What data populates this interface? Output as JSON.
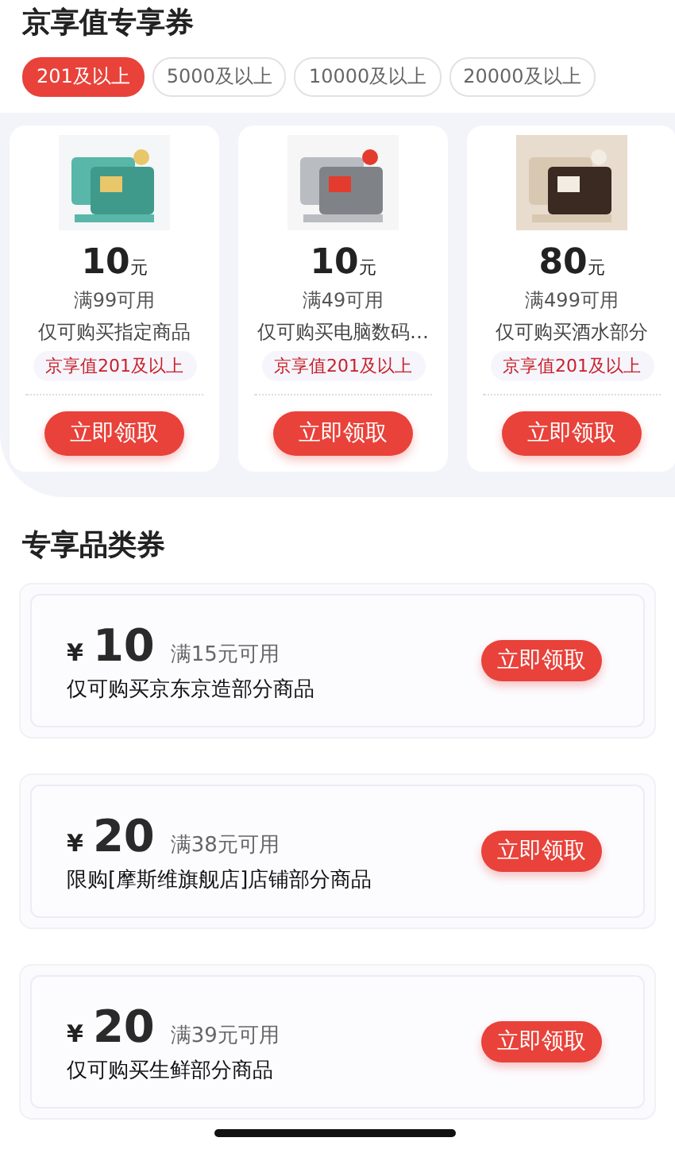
{
  "section_title": "京享值专享券",
  "tabs": [
    {
      "label": "201及以上",
      "selected": true
    },
    {
      "label": "5000及以上",
      "selected": false
    },
    {
      "label": "10000及以上",
      "selected": false
    },
    {
      "label": "20000及以上",
      "selected": false
    }
  ],
  "product_coupons": [
    {
      "amount": "10",
      "unit": "元",
      "condition": "满99可用",
      "scope": "仅可购买指定商品",
      "tag": "京享值201及以上",
      "button": "立即领取"
    },
    {
      "amount": "10",
      "unit": "元",
      "condition": "满49可用",
      "scope": "仅可购买电脑数码…",
      "tag": "京享值201及以上",
      "button": "立即领取"
    },
    {
      "amount": "80",
      "unit": "元",
      "condition": "满499可用",
      "scope": "仅可购买酒水部分",
      "tag": "京享值201及以上",
      "button": "立即领取"
    }
  ],
  "category_title": "专享品类券",
  "category_coupons": [
    {
      "currency": "¥",
      "amount": "10",
      "condition": "满15元可用",
      "scope": "仅可购买京东京造部分商品",
      "button": "立即领取"
    },
    {
      "currency": "¥",
      "amount": "20",
      "condition": "满38元可用",
      "scope": "限购[摩斯维旗舰店]店铺部分商品",
      "button": "立即领取"
    },
    {
      "currency": "¥",
      "amount": "20",
      "condition": "满39元可用",
      "scope": "仅可购买生鲜部分商品",
      "button": "立即领取"
    }
  ]
}
